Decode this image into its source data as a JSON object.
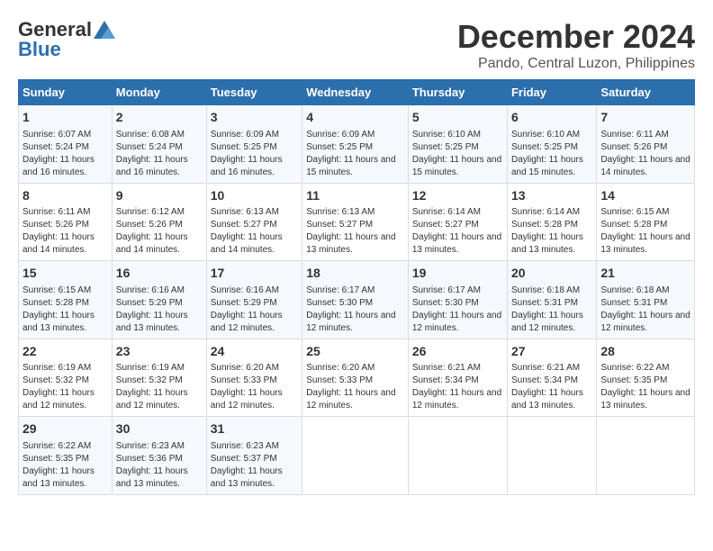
{
  "header": {
    "logo_line1": "General",
    "logo_line2": "Blue",
    "month_year": "December 2024",
    "location": "Pando, Central Luzon, Philippines"
  },
  "days_of_week": [
    "Sunday",
    "Monday",
    "Tuesday",
    "Wednesday",
    "Thursday",
    "Friday",
    "Saturday"
  ],
  "weeks": [
    [
      {
        "day": "1",
        "info": "Sunrise: 6:07 AM\nSunset: 5:24 PM\nDaylight: 11 hours and 16 minutes."
      },
      {
        "day": "2",
        "info": "Sunrise: 6:08 AM\nSunset: 5:24 PM\nDaylight: 11 hours and 16 minutes."
      },
      {
        "day": "3",
        "info": "Sunrise: 6:09 AM\nSunset: 5:25 PM\nDaylight: 11 hours and 16 minutes."
      },
      {
        "day": "4",
        "info": "Sunrise: 6:09 AM\nSunset: 5:25 PM\nDaylight: 11 hours and 15 minutes."
      },
      {
        "day": "5",
        "info": "Sunrise: 6:10 AM\nSunset: 5:25 PM\nDaylight: 11 hours and 15 minutes."
      },
      {
        "day": "6",
        "info": "Sunrise: 6:10 AM\nSunset: 5:25 PM\nDaylight: 11 hours and 15 minutes."
      },
      {
        "day": "7",
        "info": "Sunrise: 6:11 AM\nSunset: 5:26 PM\nDaylight: 11 hours and 14 minutes."
      }
    ],
    [
      {
        "day": "8",
        "info": "Sunrise: 6:11 AM\nSunset: 5:26 PM\nDaylight: 11 hours and 14 minutes."
      },
      {
        "day": "9",
        "info": "Sunrise: 6:12 AM\nSunset: 5:26 PM\nDaylight: 11 hours and 14 minutes."
      },
      {
        "day": "10",
        "info": "Sunrise: 6:13 AM\nSunset: 5:27 PM\nDaylight: 11 hours and 14 minutes."
      },
      {
        "day": "11",
        "info": "Sunrise: 6:13 AM\nSunset: 5:27 PM\nDaylight: 11 hours and 13 minutes."
      },
      {
        "day": "12",
        "info": "Sunrise: 6:14 AM\nSunset: 5:27 PM\nDaylight: 11 hours and 13 minutes."
      },
      {
        "day": "13",
        "info": "Sunrise: 6:14 AM\nSunset: 5:28 PM\nDaylight: 11 hours and 13 minutes."
      },
      {
        "day": "14",
        "info": "Sunrise: 6:15 AM\nSunset: 5:28 PM\nDaylight: 11 hours and 13 minutes."
      }
    ],
    [
      {
        "day": "15",
        "info": "Sunrise: 6:15 AM\nSunset: 5:28 PM\nDaylight: 11 hours and 13 minutes."
      },
      {
        "day": "16",
        "info": "Sunrise: 6:16 AM\nSunset: 5:29 PM\nDaylight: 11 hours and 13 minutes."
      },
      {
        "day": "17",
        "info": "Sunrise: 6:16 AM\nSunset: 5:29 PM\nDaylight: 11 hours and 12 minutes."
      },
      {
        "day": "18",
        "info": "Sunrise: 6:17 AM\nSunset: 5:30 PM\nDaylight: 11 hours and 12 minutes."
      },
      {
        "day": "19",
        "info": "Sunrise: 6:17 AM\nSunset: 5:30 PM\nDaylight: 11 hours and 12 minutes."
      },
      {
        "day": "20",
        "info": "Sunrise: 6:18 AM\nSunset: 5:31 PM\nDaylight: 11 hours and 12 minutes."
      },
      {
        "day": "21",
        "info": "Sunrise: 6:18 AM\nSunset: 5:31 PM\nDaylight: 11 hours and 12 minutes."
      }
    ],
    [
      {
        "day": "22",
        "info": "Sunrise: 6:19 AM\nSunset: 5:32 PM\nDaylight: 11 hours and 12 minutes."
      },
      {
        "day": "23",
        "info": "Sunrise: 6:19 AM\nSunset: 5:32 PM\nDaylight: 11 hours and 12 minutes."
      },
      {
        "day": "24",
        "info": "Sunrise: 6:20 AM\nSunset: 5:33 PM\nDaylight: 11 hours and 12 minutes."
      },
      {
        "day": "25",
        "info": "Sunrise: 6:20 AM\nSunset: 5:33 PM\nDaylight: 11 hours and 12 minutes."
      },
      {
        "day": "26",
        "info": "Sunrise: 6:21 AM\nSunset: 5:34 PM\nDaylight: 11 hours and 12 minutes."
      },
      {
        "day": "27",
        "info": "Sunrise: 6:21 AM\nSunset: 5:34 PM\nDaylight: 11 hours and 13 minutes."
      },
      {
        "day": "28",
        "info": "Sunrise: 6:22 AM\nSunset: 5:35 PM\nDaylight: 11 hours and 13 minutes."
      }
    ],
    [
      {
        "day": "29",
        "info": "Sunrise: 6:22 AM\nSunset: 5:35 PM\nDaylight: 11 hours and 13 minutes."
      },
      {
        "day": "30",
        "info": "Sunrise: 6:23 AM\nSunset: 5:36 PM\nDaylight: 11 hours and 13 minutes."
      },
      {
        "day": "31",
        "info": "Sunrise: 6:23 AM\nSunset: 5:37 PM\nDaylight: 11 hours and 13 minutes."
      },
      null,
      null,
      null,
      null
    ]
  ]
}
